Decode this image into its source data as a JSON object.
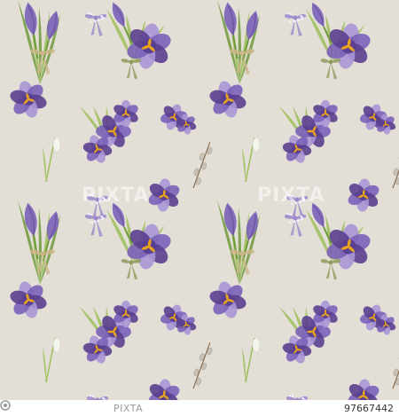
{
  "image": {
    "subject": "seamless watercolor spring pattern: purple crocus bouquets tied with ribbon bows, polka-dot lavender ribbons, snowdrops, pussy-willow twigs on a beige background",
    "palette": {
      "background": "#e3ded6",
      "petal_dark": "#5a3f8f",
      "petal_mid": "#7a62b8",
      "petal_light": "#a896d6",
      "stamen": "#e8a41c",
      "leaf": "#9cbf5a",
      "leaf_dark": "#6f9a3c",
      "ribbon_tan": "#cdb58a",
      "ribbon_olive": "#8f9a5e",
      "ribbon_lilac": "#9b87cc",
      "snowdrop": "#f4f4ef"
    }
  },
  "watermark": {
    "brand": "PIXTA"
  },
  "footer": {
    "image_id": "97667442"
  }
}
